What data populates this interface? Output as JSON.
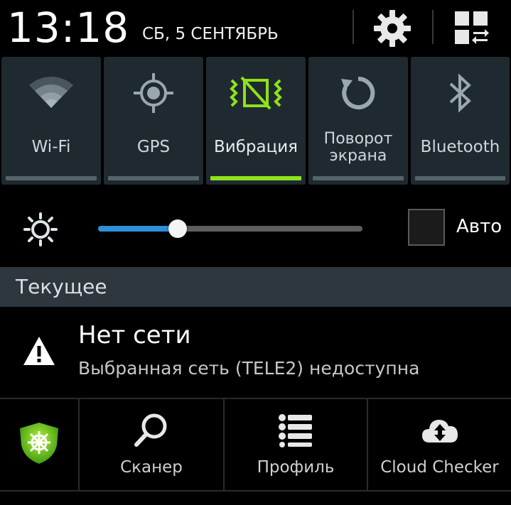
{
  "header": {
    "time": "13:18",
    "date": "СБ, 5 СЕНТЯБРЬ",
    "settings_icon": "gear-icon",
    "quick_panel_icon": "grid-toggle-icon"
  },
  "toggles": [
    {
      "label": "Wi-Fi",
      "icon": "wifi-icon",
      "active": false
    },
    {
      "label": "GPS",
      "icon": "gps-icon",
      "active": false
    },
    {
      "label": "Вибрация",
      "icon": "vibrate-icon",
      "active": true
    },
    {
      "label_line1": "Поворот",
      "label_line2": "экрана",
      "icon": "rotate-icon",
      "active": false
    },
    {
      "label": "Bluetooth",
      "icon": "bluetooth-icon",
      "active": false
    }
  ],
  "brightness": {
    "level": 0.3,
    "auto_label": "Авто",
    "auto_checked": false
  },
  "section": {
    "title": "Текущее"
  },
  "notification": {
    "title": "Нет сети",
    "text": "Выбранная сеть (TELE2) недоступна",
    "icon": "warning-icon"
  },
  "app_actions": [
    {
      "icon": "drweb-shield-icon",
      "label": ""
    },
    {
      "icon": "magnifier-icon",
      "label": "Сканер"
    },
    {
      "icon": "list-icon",
      "label": "Профиль"
    },
    {
      "icon": "cloud-sync-icon",
      "label": "Cloud Checker"
    }
  ],
  "colors": {
    "accent_active": "#8ee21a",
    "slider_fill": "#2d8fd9",
    "tile_bg": "#1f2a30",
    "section_bg": "#2d373d"
  }
}
